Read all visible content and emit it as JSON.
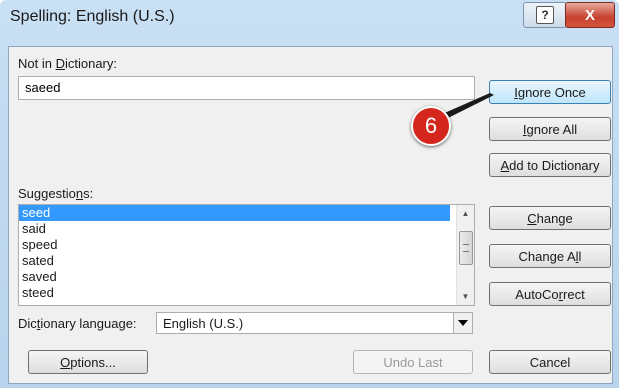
{
  "window": {
    "title": "Spelling: English (U.S.)",
    "help_label": "?",
    "close_label": "X"
  },
  "not_in_dictionary": {
    "label_pre": "Not in ",
    "label_accel": "D",
    "label_post": "ictionary:",
    "value": "saeed"
  },
  "suggestions": {
    "label_pre": "Suggestio",
    "label_accel": "n",
    "label_post": "s:",
    "items": [
      {
        "text": "seed",
        "selected": true
      },
      {
        "text": "said",
        "selected": false
      },
      {
        "text": "speed",
        "selected": false
      },
      {
        "text": "sated",
        "selected": false
      },
      {
        "text": "saved",
        "selected": false
      },
      {
        "text": "steed",
        "selected": false
      }
    ]
  },
  "dictionary_language": {
    "label_pre": "Dic",
    "label_accel": "t",
    "label_post": "ionary language:",
    "value": "English (U.S.)"
  },
  "buttons": {
    "ignore_once": {
      "accel": "I",
      "rest": "gnore Once"
    },
    "ignore_all": {
      "accel": "I",
      "rest": "gnore All"
    },
    "add_to_dictionary": {
      "accel": "A",
      "rest": "dd to Dictionary"
    },
    "change": {
      "accel": "C",
      "rest": "hange"
    },
    "change_all": {
      "pre": "Change A",
      "accel": "l",
      "rest": "l"
    },
    "autocorrect": {
      "pre": "AutoCo",
      "accel": "r",
      "rest": "rect"
    },
    "options": {
      "accel": "O",
      "rest": "ptions..."
    },
    "undo_last": "Undo Last",
    "cancel": "Cancel"
  },
  "annotation": {
    "step_number": "6",
    "color": "#d4261c"
  },
  "icons": {
    "help": "question-mark-icon",
    "close": "close-x-icon",
    "dropdown": "triangle-down-icon",
    "scroll_up": "triangle-up-icon",
    "scroll_down": "triangle-down-icon"
  }
}
